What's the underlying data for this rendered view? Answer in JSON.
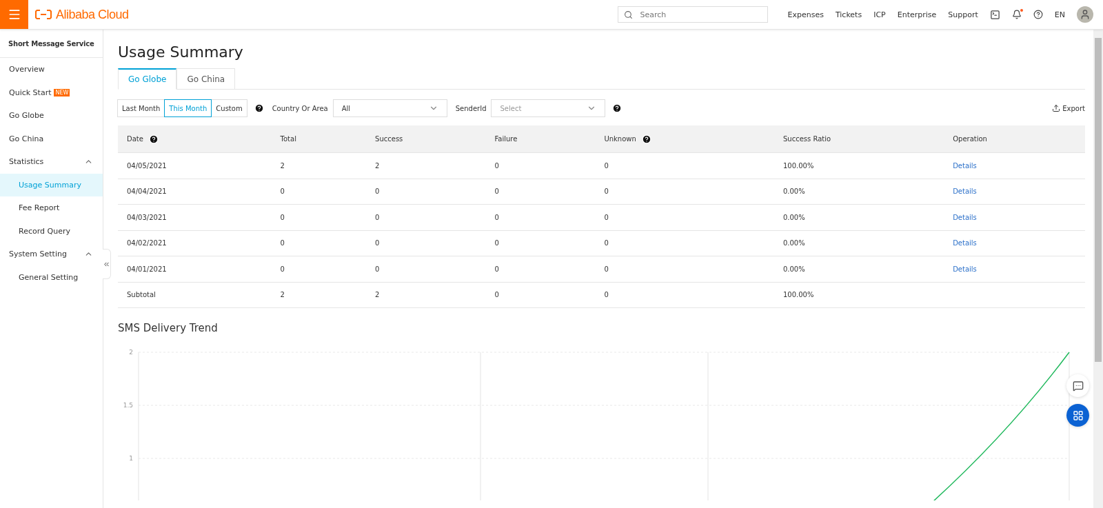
{
  "topbar": {
    "brand": "Alibaba Cloud",
    "search": {
      "placeholder": "Search"
    },
    "links": [
      "Expenses",
      "Tickets",
      "ICP",
      "Enterprise",
      "Support"
    ],
    "language": "EN"
  },
  "sidebar": {
    "title": "Short Message Service",
    "items": [
      {
        "label": "Overview",
        "selected": false
      },
      {
        "label": "Quick Start",
        "badge": "NEW",
        "selected": false
      },
      {
        "label": "Go Globe",
        "selected": false
      },
      {
        "label": "Go China",
        "selected": false
      },
      {
        "label": "Statistics",
        "expanded": true,
        "children": [
          {
            "label": "Usage Summary",
            "selected": true
          },
          {
            "label": "Fee Report",
            "selected": false
          },
          {
            "label": "Record Query",
            "selected": false
          }
        ]
      },
      {
        "label": "System Setting",
        "expanded": true,
        "children": [
          {
            "label": "General Setting",
            "selected": false
          }
        ]
      }
    ]
  },
  "page": {
    "title": "Usage Summary",
    "tabs": [
      {
        "label": "Go Globe",
        "selected": true
      },
      {
        "label": "Go China",
        "selected": false
      }
    ],
    "ranges": [
      {
        "label": "Last Month",
        "selected": false
      },
      {
        "label": "This Month",
        "selected": true
      },
      {
        "label": "Custom",
        "selected": false
      }
    ],
    "filters": [
      {
        "label": "Country Or Area",
        "value": "All"
      },
      {
        "label": "SenderId",
        "placeholder": "Select",
        "help": true
      }
    ],
    "export": "Export",
    "table": {
      "columns": [
        {
          "label": "Date",
          "help": true
        },
        {
          "label": "Total",
          "help": false
        },
        {
          "label": "Success",
          "help": false
        },
        {
          "label": "Failure",
          "help": false
        },
        {
          "label": "Unknown",
          "help": true
        },
        {
          "label": "Success Ratio",
          "help": false
        },
        {
          "label": "Operation",
          "help": false
        }
      ],
      "rows": [
        {
          "date": "04/05/2021",
          "total": "2",
          "success": "2",
          "failure": "0",
          "unknown": "0",
          "ratio": "100.00%",
          "operation": "Details"
        },
        {
          "date": "04/04/2021",
          "total": "0",
          "success": "0",
          "failure": "0",
          "unknown": "0",
          "ratio": "0.00%",
          "operation": "Details"
        },
        {
          "date": "04/03/2021",
          "total": "0",
          "success": "0",
          "failure": "0",
          "unknown": "0",
          "ratio": "0.00%",
          "operation": "Details"
        },
        {
          "date": "04/02/2021",
          "total": "0",
          "success": "0",
          "failure": "0",
          "unknown": "0",
          "ratio": "0.00%",
          "operation": "Details"
        },
        {
          "date": "04/01/2021",
          "total": "0",
          "success": "0",
          "failure": "0",
          "unknown": "0",
          "ratio": "0.00%",
          "operation": "Details"
        },
        {
          "date": "Subtotal",
          "total": "2",
          "success": "2",
          "failure": "0",
          "unknown": "0",
          "ratio": "100.00%"
        }
      ]
    },
    "trend": {
      "title": "SMS Delivery Trend",
      "y_labels": [
        "2",
        "1.5",
        "1"
      ]
    }
  }
}
